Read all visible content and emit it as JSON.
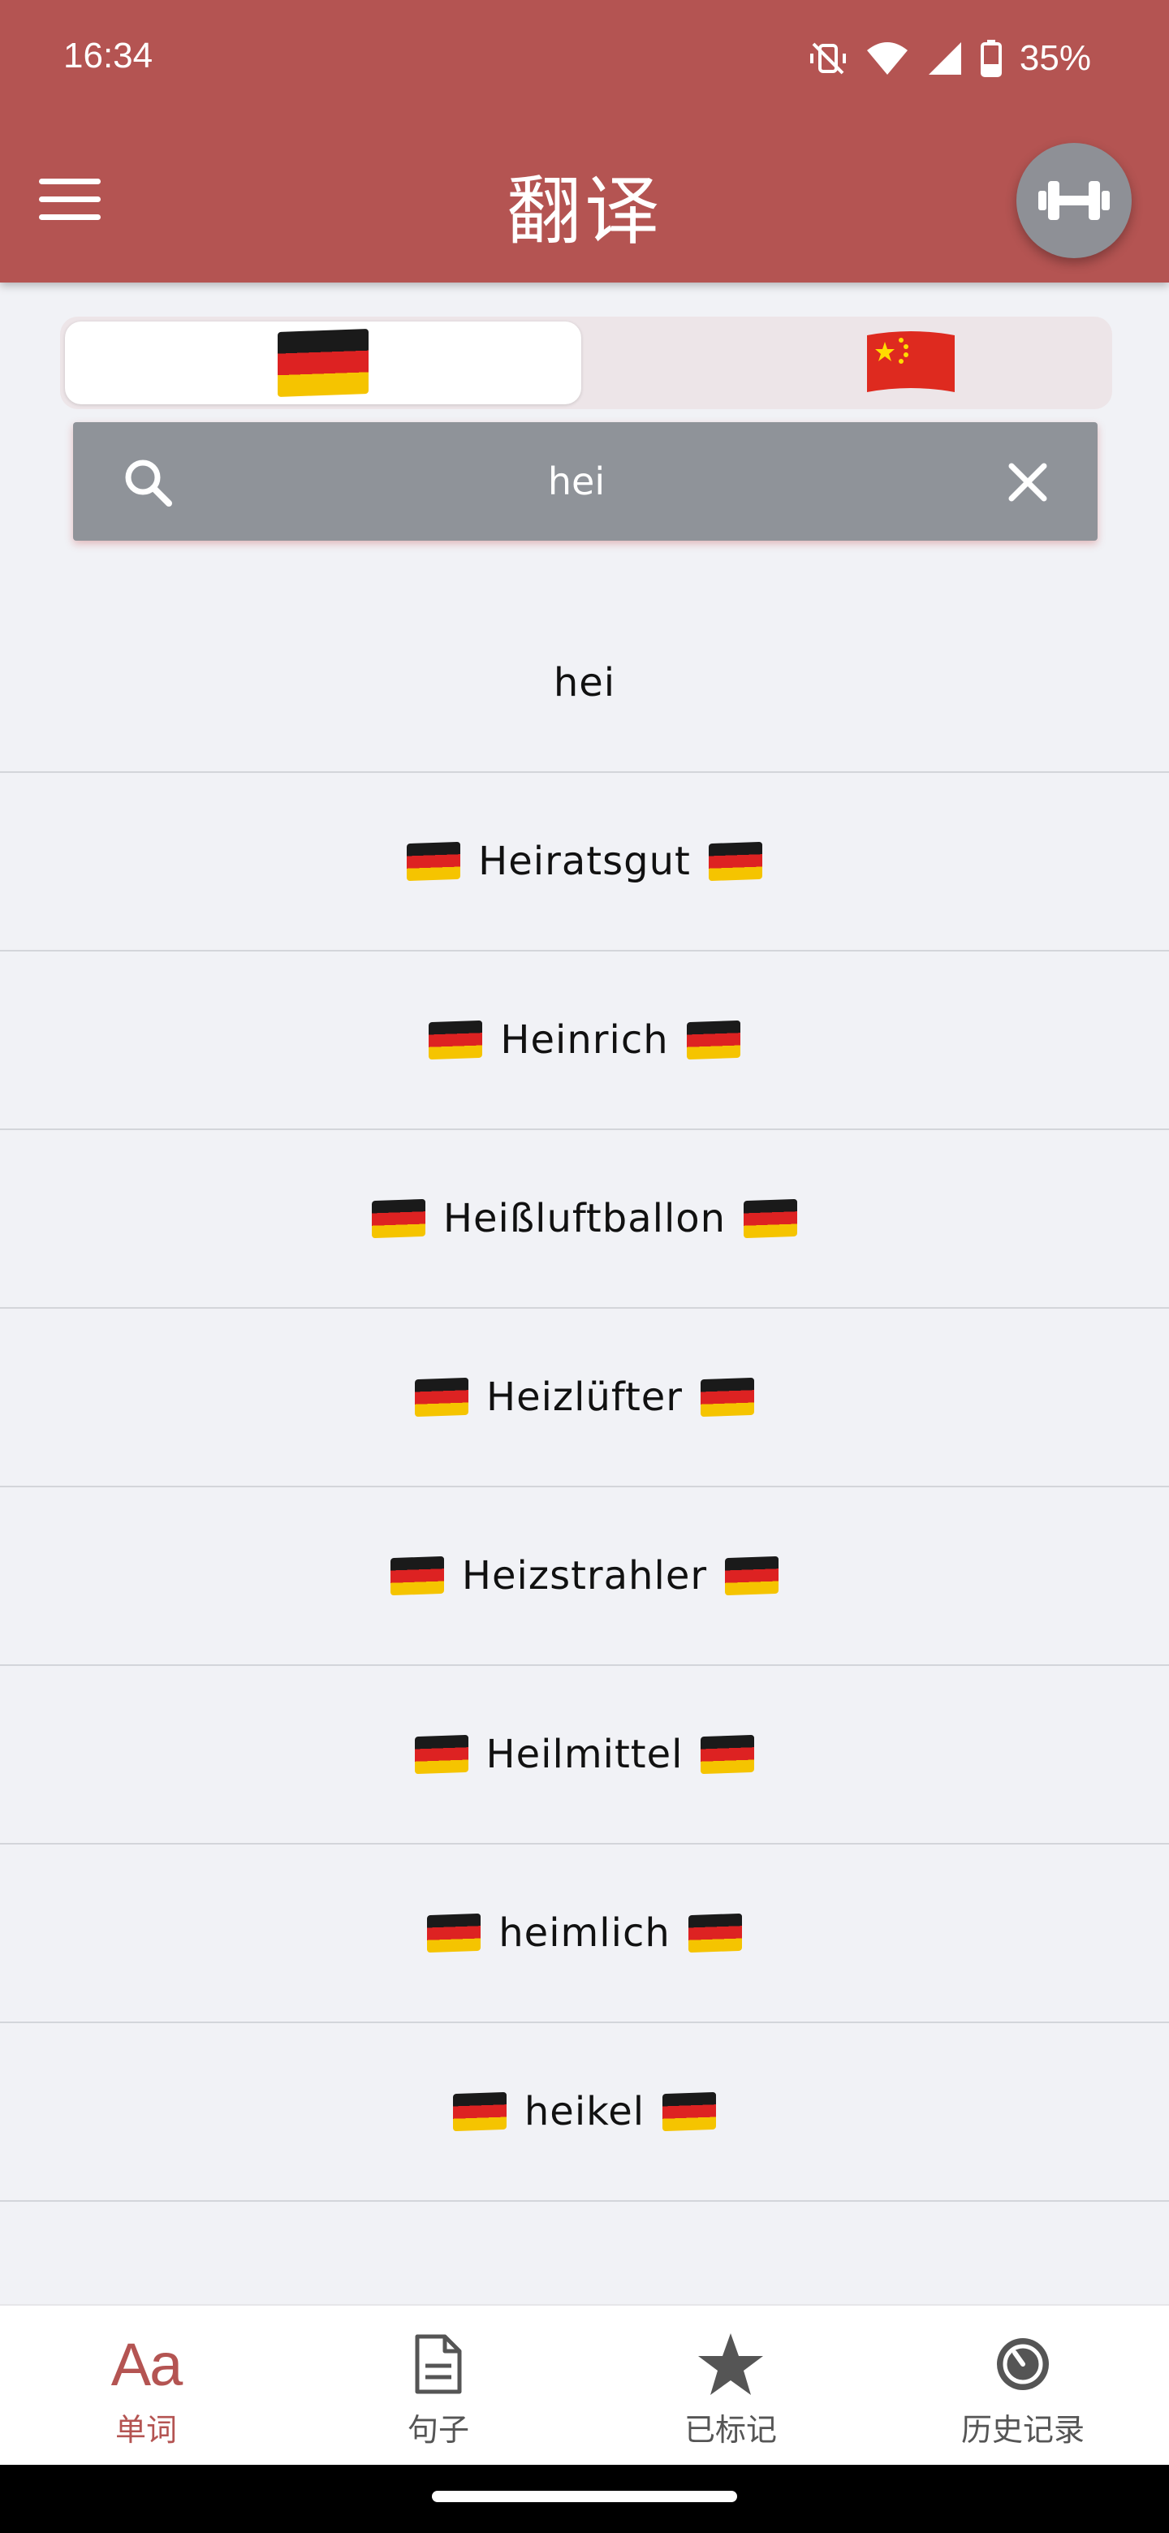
{
  "status": {
    "time": "16:34",
    "battery": "35%"
  },
  "header": {
    "title": "翻译"
  },
  "language_toggle": {
    "active": "German",
    "options": [
      "German",
      "Chinese"
    ]
  },
  "search": {
    "value": "hei",
    "placeholder": ""
  },
  "results": [
    {
      "word": "hei",
      "flagged": false
    },
    {
      "word": "Heiratsgut",
      "flagged": true
    },
    {
      "word": "Heinrich",
      "flagged": true
    },
    {
      "word": "Heißluftballon",
      "flagged": true
    },
    {
      "word": "Heizlüfter",
      "flagged": true
    },
    {
      "word": "Heizstrahler",
      "flagged": true
    },
    {
      "word": "Heilmittel",
      "flagged": true
    },
    {
      "word": "heimlich",
      "flagged": true
    },
    {
      "word": "heikel",
      "flagged": true
    }
  ],
  "bottom_nav": {
    "words": "单词",
    "sentences": "句子",
    "marked": "已标记",
    "history": "历史记录"
  },
  "colors": {
    "primary": "#b45452",
    "search_bg": "#8f9399",
    "background": "#f1f2f6"
  }
}
